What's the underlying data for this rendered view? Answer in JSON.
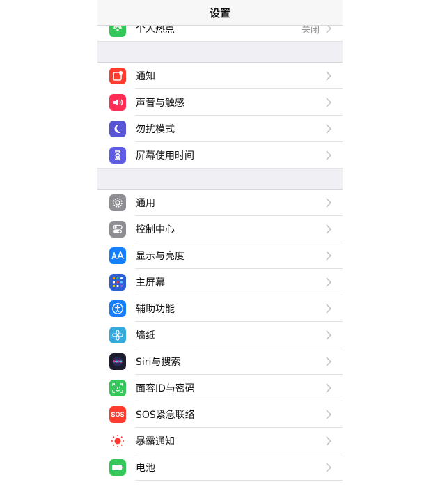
{
  "nav": {
    "title": "设置"
  },
  "groups": [
    {
      "rows": [
        {
          "label": "个人热点",
          "value": "关闭",
          "icon": "hotspot-icon",
          "color": "#34c759"
        }
      ]
    },
    {
      "rows": [
        {
          "label": "通知",
          "icon": "notification-icon",
          "color": "#ff3b30"
        },
        {
          "label": "声音与触感",
          "icon": "speaker-icon",
          "color": "#ff2d55"
        },
        {
          "label": "勿扰模式",
          "icon": "moon-icon",
          "color": "#5856d6"
        },
        {
          "label": "屏幕使用时间",
          "icon": "hourglass-icon",
          "color": "#5e5ce6"
        }
      ]
    },
    {
      "rows": [
        {
          "label": "通用",
          "icon": "gear-icon",
          "color": "#8e8e93"
        },
        {
          "label": "控制中心",
          "icon": "toggles-icon",
          "color": "#8e8e93"
        },
        {
          "label": "显示与亮度",
          "icon": "text-size-icon",
          "color": "#147efb"
        },
        {
          "label": "主屏幕",
          "icon": "home-grid-icon",
          "color": "#2c5fd4"
        },
        {
          "label": "辅助功能",
          "icon": "accessibility-icon",
          "color": "#147efb"
        },
        {
          "label": "墙纸",
          "icon": "flower-icon",
          "color": "#35aadc"
        },
        {
          "label": "Siri与搜索",
          "icon": "siri-icon",
          "color": "#1c1c2e"
        },
        {
          "label": "面容ID与密码",
          "icon": "faceid-icon",
          "color": "#34c759"
        },
        {
          "label": "SOS紧急联络",
          "icon": "sos-icon",
          "color": "#ff3b30",
          "badge": "SOS"
        },
        {
          "label": "暴露通知",
          "icon": "exposure-icon",
          "color": "#ffffff"
        },
        {
          "label": "电池",
          "icon": "battery-icon",
          "color": "#34c759"
        }
      ]
    }
  ]
}
